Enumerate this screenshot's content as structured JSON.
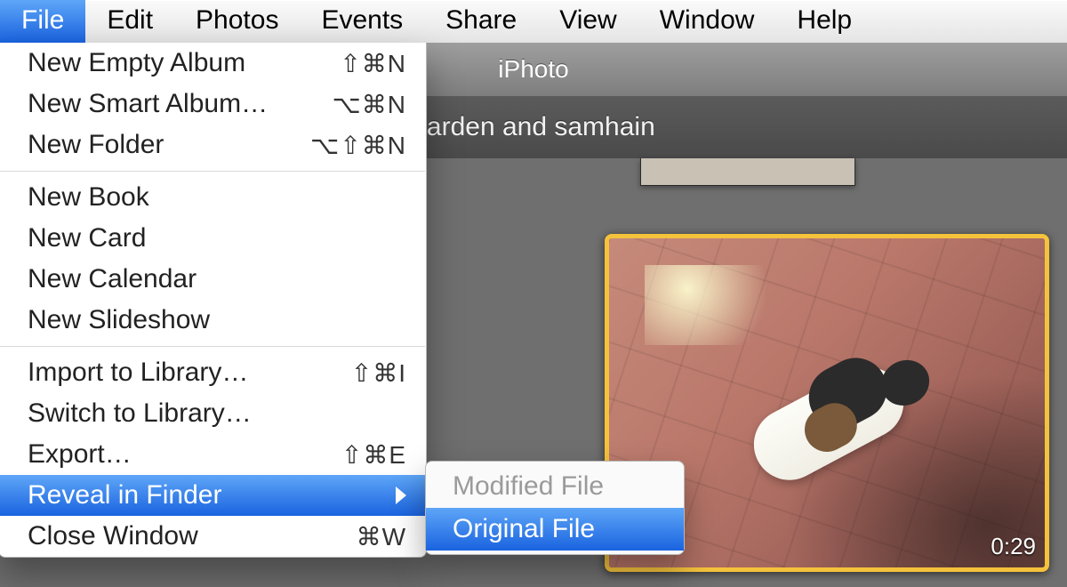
{
  "menubar": {
    "items": [
      {
        "label": "File",
        "active": true
      },
      {
        "label": "Edit"
      },
      {
        "label": "Photos"
      },
      {
        "label": "Events"
      },
      {
        "label": "Share"
      },
      {
        "label": "View"
      },
      {
        "label": "Window"
      },
      {
        "label": "Help"
      }
    ]
  },
  "window": {
    "title": "iPhoto",
    "event_title": "garden and samhain"
  },
  "thumbnail": {
    "duration": "0:29",
    "selected": true
  },
  "file_menu": {
    "groups": [
      [
        {
          "label": "New Empty Album",
          "shortcut": "⇧⌘N"
        },
        {
          "label": "New Smart Album…",
          "shortcut": "⌥⌘N"
        },
        {
          "label": "New Folder",
          "shortcut": "⌥⇧⌘N"
        }
      ],
      [
        {
          "label": "New Book"
        },
        {
          "label": "New Card"
        },
        {
          "label": "New Calendar"
        },
        {
          "label": "New Slideshow"
        }
      ],
      [
        {
          "label": "Import to Library…",
          "shortcut": "⇧⌘I"
        },
        {
          "label": "Switch to Library…"
        },
        {
          "label": "Export…",
          "shortcut": "⇧⌘E"
        },
        {
          "label": "Reveal in Finder",
          "submenu": true,
          "highlight": true
        },
        {
          "label": "Close Window",
          "shortcut": "⌘W"
        }
      ]
    ]
  },
  "reveal_submenu": {
    "items": [
      {
        "label": "Modified File",
        "enabled": false
      },
      {
        "label": "Original File",
        "enabled": true,
        "highlight": true
      }
    ]
  }
}
